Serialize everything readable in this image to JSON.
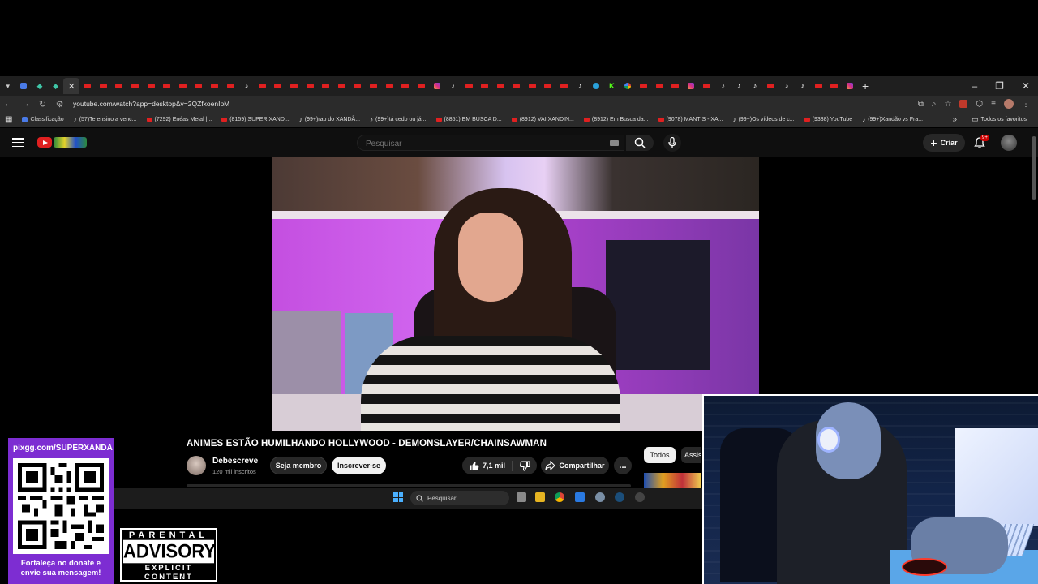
{
  "browser": {
    "url": "youtube.com/watch?app=desktop&v=2QZfxoenIpM",
    "bookmarks": [
      {
        "icon": "globe",
        "label": "Classificação"
      },
      {
        "icon": "tiktok",
        "label": "(57)Te ensino a venc..."
      },
      {
        "icon": "youtube",
        "label": "(7292) Enéas Metal |..."
      },
      {
        "icon": "youtube",
        "label": "(8159) SUPER XAND..."
      },
      {
        "icon": "tiktok",
        "label": "(99+)rap do XANDÃ..."
      },
      {
        "icon": "tiktok",
        "label": "(99+)tá cedo ou já..."
      },
      {
        "icon": "youtube",
        "label": "(8851) EM BUSCA D..."
      },
      {
        "icon": "youtube",
        "label": "(8912) VAI XANDIN..."
      },
      {
        "icon": "youtube",
        "label": "(8912) Em Busca da..."
      },
      {
        "icon": "youtube",
        "label": "(9078) MANTIS - XA..."
      },
      {
        "icon": "tiktok",
        "label": "(99+)Os vídeos de c..."
      },
      {
        "icon": "youtube",
        "label": "(9338) YouTube"
      },
      {
        "icon": "tiktok",
        "label": "(99+)Xandão vs Fra..."
      }
    ],
    "all_bookmarks_label": "Todos os favoritos"
  },
  "youtube": {
    "search_placeholder": "Pesquisar",
    "create_label": "Criar",
    "notification_badge": "9+",
    "video": {
      "title": "ANIMES ESTÃO HUMILHANDO HOLLYWOOD - DEMONSLAYER/CHAINSAWMAN",
      "channel": "Debescreve",
      "subscribers": "120 mil inscritos",
      "member_label": "Seja membro",
      "subscribe_label": "Inscrever-se",
      "likes": "7,1 mil",
      "share_label": "Compartilhar",
      "more_label": "..."
    },
    "chips": [
      "Todos",
      "Assis"
    ]
  },
  "taskbar": {
    "search_placeholder": "Pesquisar"
  },
  "overlay": {
    "donate_url": "pixgg.com/SUPERXANDA",
    "donate_message_line1": "Fortaleça no donate e",
    "donate_message_line2": "envie sua mensagem!",
    "advisory_line1": "PARENTAL",
    "advisory_line2": "ADVISORY",
    "advisory_line3": "EXPLICIT CONTENT"
  },
  "colors": {
    "youtube_red": "#e02020",
    "donate_purple": "#7d2dd2",
    "subscribe_bg": "#f1f1f1"
  }
}
